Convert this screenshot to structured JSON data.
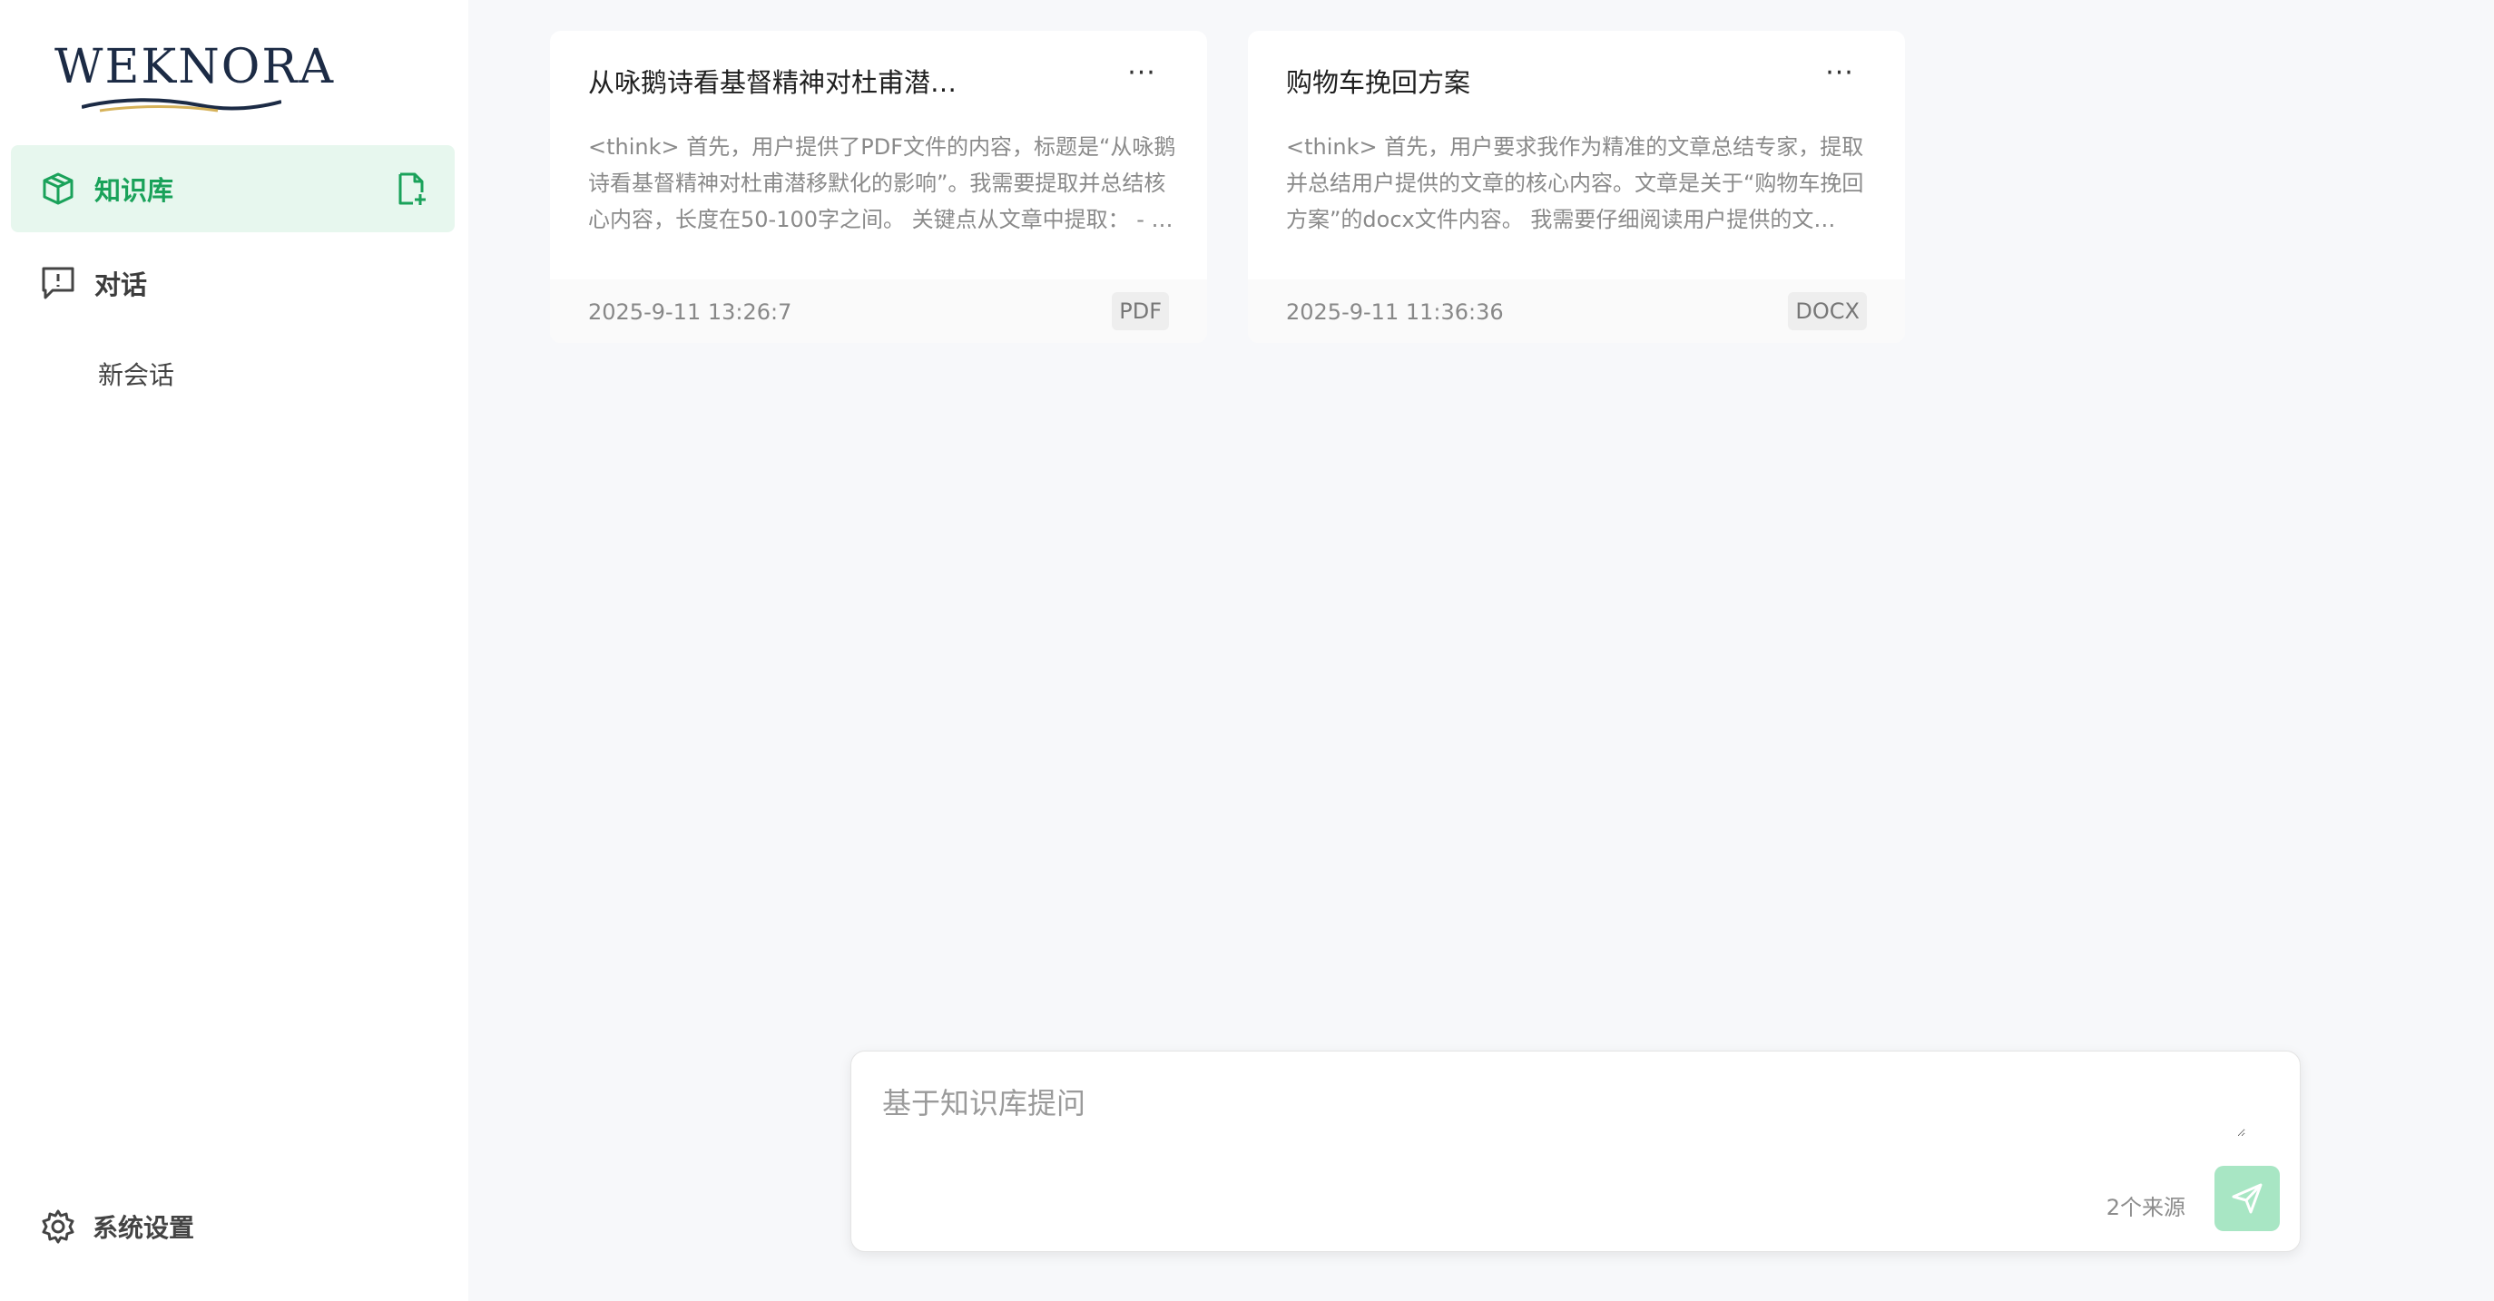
{
  "app": {
    "logo_text": "WEKNORA"
  },
  "sidebar": {
    "items": [
      {
        "label": "知识库",
        "icon": "cube-icon",
        "active": true
      },
      {
        "label": "对话",
        "icon": "chat-icon",
        "active": false
      }
    ],
    "sessions": [
      {
        "label": "新会话"
      }
    ],
    "settings_label": "系统设置",
    "upload_icon": "file-add-icon"
  },
  "cards": [
    {
      "title": "从咏鹅诗看基督精神对杜甫潜…",
      "summary": "<think> 首先，用户提供了PDF文件的内容，标题是“从咏鹅诗看基督精神对杜甫潜移默化的影响”。我需要提取并总结核心内容，长度在50-100字之间。 关键点从文章中提取： - …",
      "date": "2025-9-11 13:26:7",
      "type": "PDF",
      "menu": "···"
    },
    {
      "title": "购物车挽回方案",
      "summary": "<think> 首先，用户要求我作为精准的文章总结专家，提取并总结用户提供的文章的核心内容。文章是关于“购物车挽回方案”的docx文件内容。 我需要仔细阅读用户提供的文…",
      "date": "2025-9-11 11:36:36",
      "type": "DOCX",
      "menu": "···"
    }
  ],
  "chat": {
    "placeholder": "基于知识库提问",
    "value": "",
    "source_count": "2个来源"
  },
  "colors": {
    "accent": "#1aa25a",
    "accent_light": "#e7f7ee",
    "send_button": "#a8e6c4",
    "background": "#f7f8fa"
  }
}
